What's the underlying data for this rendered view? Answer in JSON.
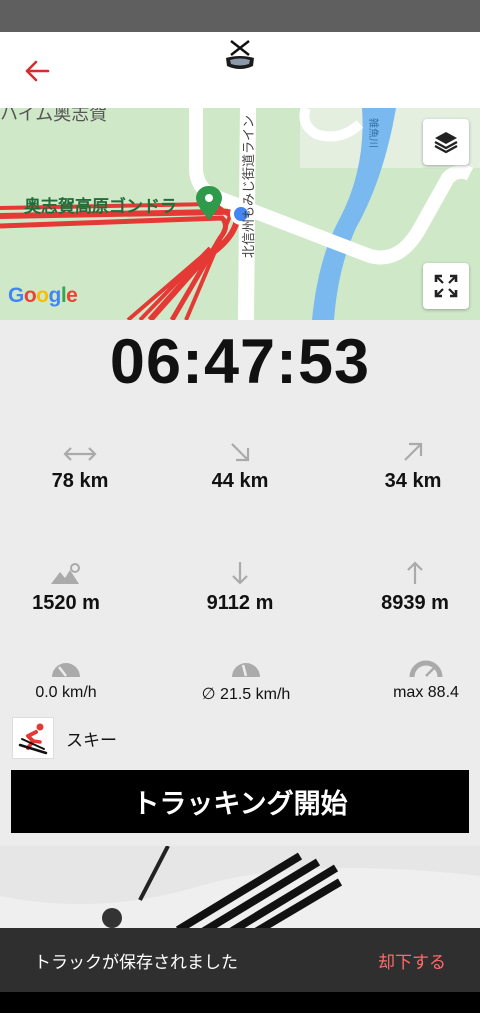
{
  "map": {
    "place_top": "ハイム奥志賀",
    "place_gondola": "奥志賀高原ゴンドラ",
    "road_label": "北信州もみじ街道ライン",
    "river_label": "雑魚川",
    "attribution": "Google",
    "layers_icon": "layers-icon",
    "fullscreen_icon": "fullscreen-icon"
  },
  "timer": "06:47:53",
  "stats": {
    "distance": "78 km",
    "downhill_distance": "44 km",
    "uphill_distance": "34 km",
    "altitude": "1520 m",
    "descent": "9112 m",
    "ascent": "8939 m",
    "current_speed": "0.0 km/h",
    "avg_speed": "∅ 21.5 km/h",
    "max_speed": "max 88.4"
  },
  "sport": {
    "label": "スキー",
    "icon": "skier-icon"
  },
  "start_button": "トラッキング開始",
  "snackbar": {
    "message": "トラックが保存されました",
    "action": "却下する"
  },
  "colors": {
    "accent": "#d32f2f",
    "route": "#e53935",
    "snack_action": "#ff6b6b"
  }
}
